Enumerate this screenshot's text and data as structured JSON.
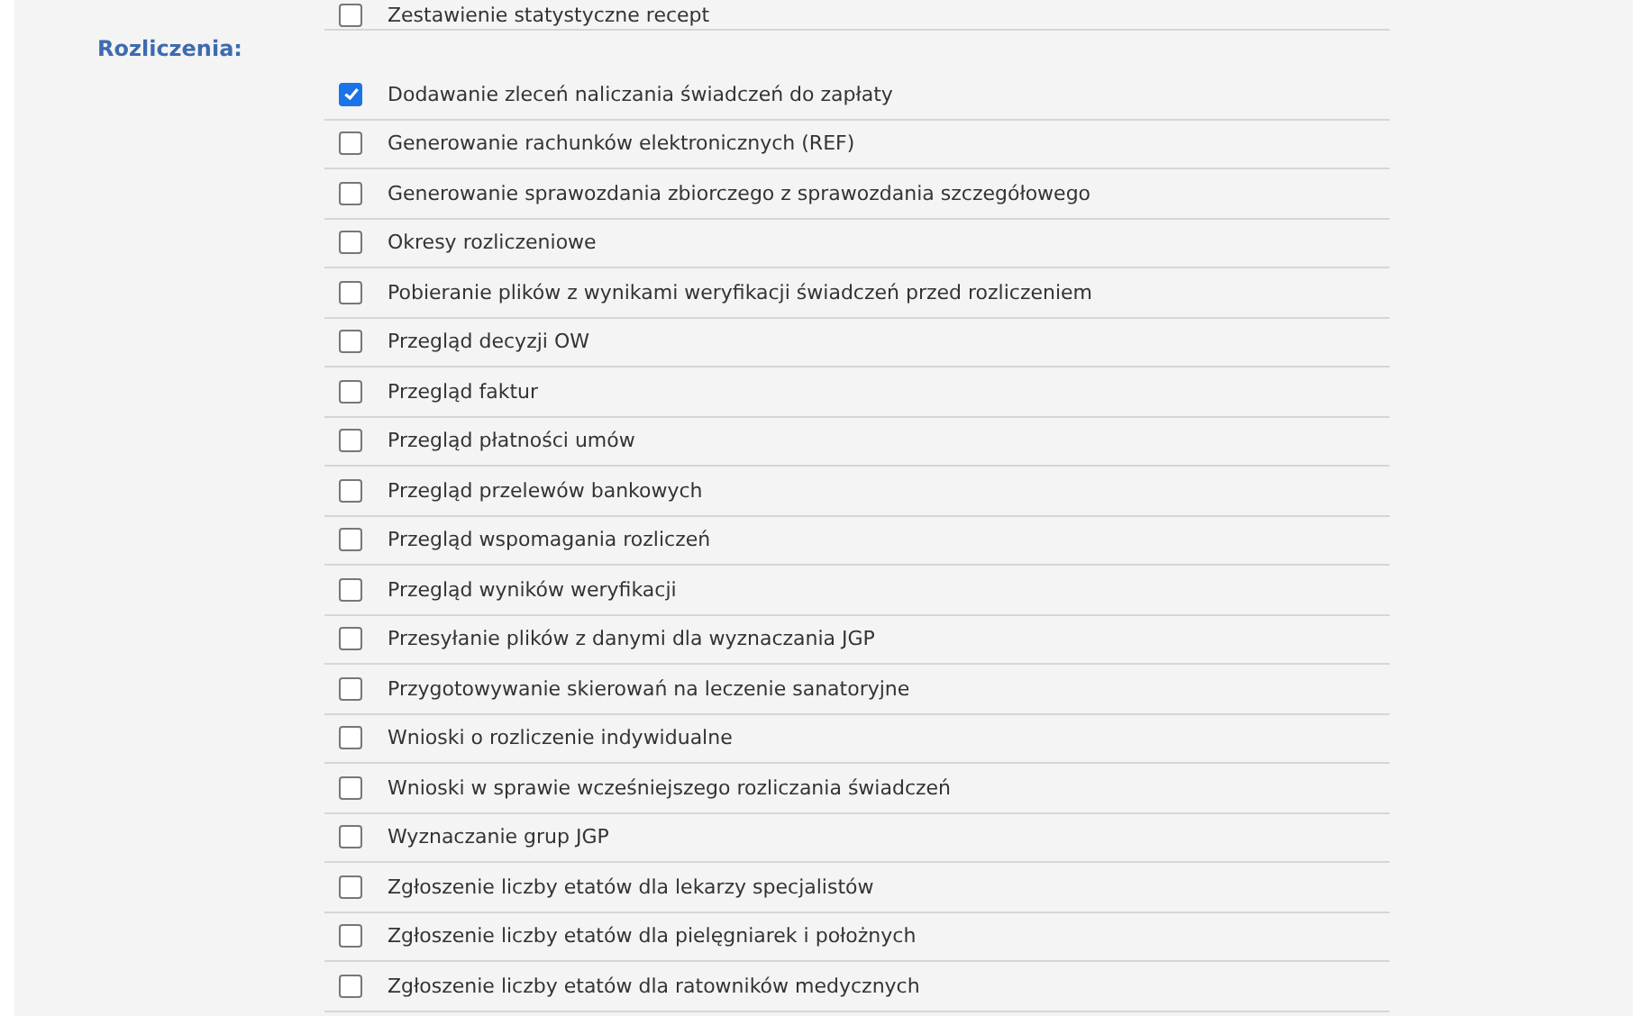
{
  "previous_section": {
    "items": [
      {
        "label": "Zestawienie statystyczne recept",
        "checked": false
      }
    ]
  },
  "section": {
    "title": "Rozliczenia:",
    "items": [
      {
        "label": "Dodawanie zleceń naliczania świadczeń do zapłaty",
        "checked": true
      },
      {
        "label": "Generowanie rachunków elektronicznych (REF)",
        "checked": false
      },
      {
        "label": "Generowanie sprawozdania zbiorczego z sprawozdania szczegółowego",
        "checked": false
      },
      {
        "label": "Okresy rozliczeniowe",
        "checked": false
      },
      {
        "label": "Pobieranie plików z wynikami weryfikacji świadczeń przed rozliczeniem",
        "checked": false
      },
      {
        "label": "Przegląd decyzji OW",
        "checked": false
      },
      {
        "label": "Przegląd faktur",
        "checked": false
      },
      {
        "label": "Przegląd płatności umów",
        "checked": false
      },
      {
        "label": "Przegląd przelewów bankowych",
        "checked": false
      },
      {
        "label": "Przegląd wspomagania rozliczeń",
        "checked": false
      },
      {
        "label": "Przegląd wyników weryfikacji",
        "checked": false
      },
      {
        "label": "Przesyłanie plików z danymi dla wyznaczania JGP",
        "checked": false
      },
      {
        "label": "Przygotowywanie skierowań na leczenie sanatoryjne",
        "checked": false
      },
      {
        "label": "Wnioski o rozliczenie indywidualne",
        "checked": false
      },
      {
        "label": "Wnioski w sprawie wcześniejszego rozliczania świadczeń",
        "checked": false
      },
      {
        "label": "Wyznaczanie grup JGP",
        "checked": false
      },
      {
        "label": "Zgłoszenie liczby etatów dla lekarzy specjalistów",
        "checked": false
      },
      {
        "label": "Zgłoszenie liczby etatów dla pielęgniarek i położnych",
        "checked": false
      },
      {
        "label": "Zgłoszenie liczby etatów dla ratowników medycznych",
        "checked": false
      }
    ]
  }
}
